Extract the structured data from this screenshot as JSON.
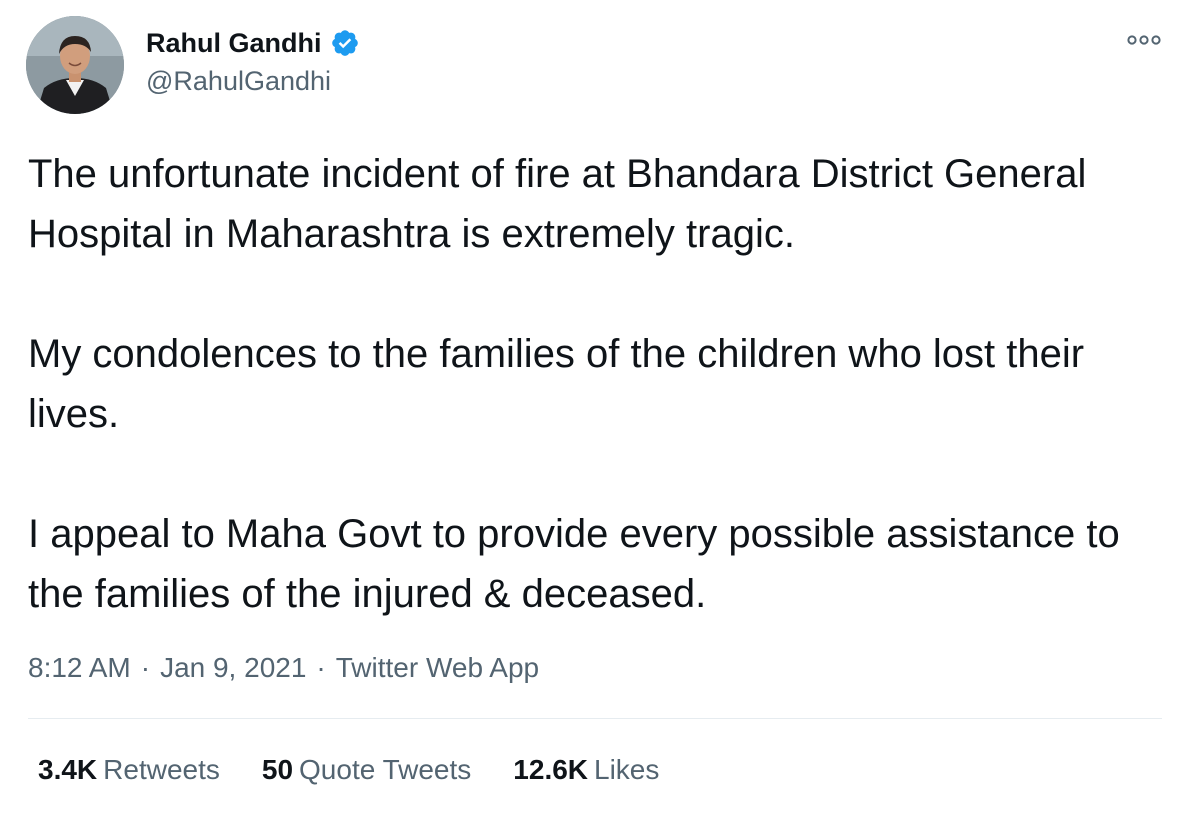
{
  "author": {
    "display_name": "Rahul Gandhi",
    "handle": "@RahulGandhi",
    "verified": true,
    "avatar_icon": "profile-photo"
  },
  "tweet": {
    "paragraphs": [
      "The unfortunate incident of fire at Bhandara District General Hospital in Maharashtra is extremely tragic.",
      "My condolences to the families of the children who lost their lives.",
      "I appeal to Maha Govt to provide every possible assistance to the families of the injured & deceased."
    ]
  },
  "meta": {
    "time": "8:12 AM",
    "separator": "·",
    "date": "Jan 9, 2021",
    "source": "Twitter Web App"
  },
  "stats": {
    "retweets_count": "3.4K",
    "retweets_label": "Retweets",
    "quotes_count": "50",
    "quotes_label": "Quote Tweets",
    "likes_count": "12.6K",
    "likes_label": "Likes"
  },
  "colors": {
    "verified_blue": "#1d9bf0",
    "text_primary": "#0f1419",
    "text_secondary": "#536471",
    "divider": "#e6ecf0"
  },
  "icons": {
    "more": "more-horizontal-icon",
    "verified": "verified-badge-icon"
  }
}
